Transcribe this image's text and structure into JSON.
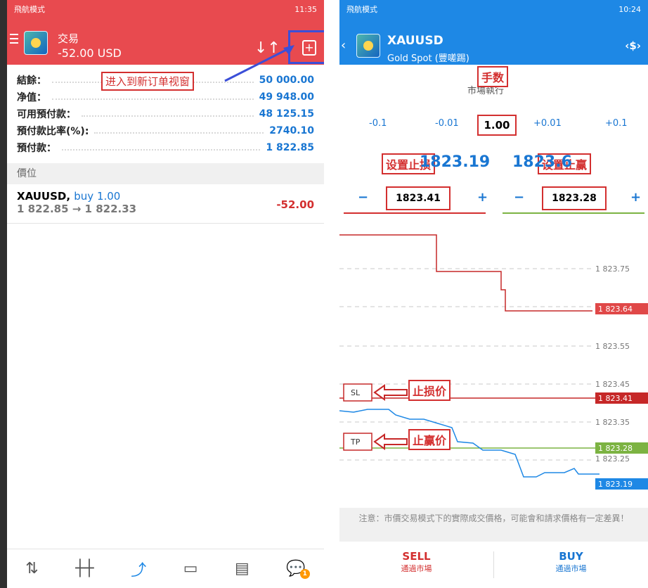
{
  "left": {
    "status": {
      "left": "飛航模式",
      "right": "11:35"
    },
    "header": {
      "title": "交易",
      "balance_line": "-52.00 USD"
    },
    "callout": "进入到新订单视窗",
    "account": [
      {
        "label": "結餘：",
        "value": "50 000.00"
      },
      {
        "label": "净值：",
        "value": "49 948.00"
      },
      {
        "label": "可用預付款：",
        "value": "48 125.15"
      },
      {
        "label": "預付款比率(%):",
        "value": "2740.10"
      },
      {
        "label": "預付款：",
        "value": "1 822.85"
      }
    ],
    "section": "價位",
    "position": {
      "symbol": "XAUUSD,",
      "side": "buy 1.00",
      "prices": "1 822.85 → 1 822.33",
      "pl": "-52.00"
    },
    "nav_badge": "1"
  },
  "right": {
    "status": {
      "left": "飛航模式",
      "right": "10:24"
    },
    "header": {
      "symbol": "XAUUSD",
      "desc": "Gold Spot (豐嗟踢)"
    },
    "anno": {
      "volume": "手数",
      "sl": "设置止损",
      "tp": "设置止赢",
      "sl_price": "止损价",
      "tp_price": "止赢价"
    },
    "exec_mode": "市場執行",
    "steps": [
      "-0.1",
      "-0.01",
      "+0.01",
      "+0.1"
    ],
    "volume": "1.00",
    "bid": "1823.19",
    "ask": "1823.6",
    "sl_value": "1823.41",
    "tp_value": "1823.28",
    "chart_labels": {
      "sl": "SL",
      "tp": "TP"
    },
    "chart_prices": [
      "1 823.75",
      "1 823.64",
      "1 823.55",
      "1 823.45",
      "1 823.41",
      "1 823.35",
      "1 823.28",
      "1 823.25",
      "1 823.19"
    ],
    "notice": "注意：市價交易模式下的實際成交價格，可能會和請求價格有一定差異！",
    "sell": {
      "label": "SELL",
      "sub": "通過市場"
    },
    "buy": {
      "label": "BUY",
      "sub": "通過市場"
    }
  }
}
